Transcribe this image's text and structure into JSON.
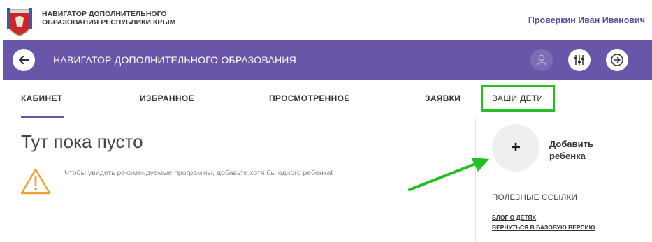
{
  "header": {
    "site_name_line1": "НАВИГАТОР ДОПОЛНИТЕЛЬНОГО",
    "site_name_line2": "ОБРАЗОВАНИЯ РЕСПУБЛИКИ КРЫМ",
    "user_name": "Проверкин Иван Иванович",
    "logo_icon": "crimea-coat-of-arms-icon"
  },
  "navbar": {
    "title": "НАВИГАТОР ДОПОЛНИТЕЛЬНОГО ОБРАЗОВАНИЯ",
    "back_icon": "arrow-left-icon",
    "avatar_icon": "user-icon",
    "filter_icon": "sliders-icon",
    "exit_icon": "arrow-right-circle-icon",
    "color": "#6a56a8"
  },
  "tabs": [
    {
      "label": "КАБИНЕТ",
      "active": true
    },
    {
      "label": "ИЗБРАННОЕ"
    },
    {
      "label": "ПРОСМОТРЕННОЕ"
    },
    {
      "label": "ЗАЯВКИ"
    },
    {
      "label": "ВАШИ ДЕТИ",
      "highlighted": true
    }
  ],
  "main": {
    "empty_title": "Тут пока пусто",
    "hint": "Чтобы увидеть рекомендуемые программы, добавьте хотя бы одного ребенка!",
    "warning_icon": "warning-triangle-icon"
  },
  "sidebar": {
    "add_symbol": "+",
    "add_line1": "Добавить",
    "add_line2": "ребенка",
    "links_title": "ПОЛЕЗНЫЕ ССЫЛКИ",
    "links": [
      "БЛОГ О ДЕТЯХ",
      "ВЕРНУТЬСЯ В БАЗОВУЮ ВЕРСИЮ"
    ]
  },
  "annotation": {
    "highlight_color": "#22c022",
    "arrow_icon": "green-arrow"
  }
}
